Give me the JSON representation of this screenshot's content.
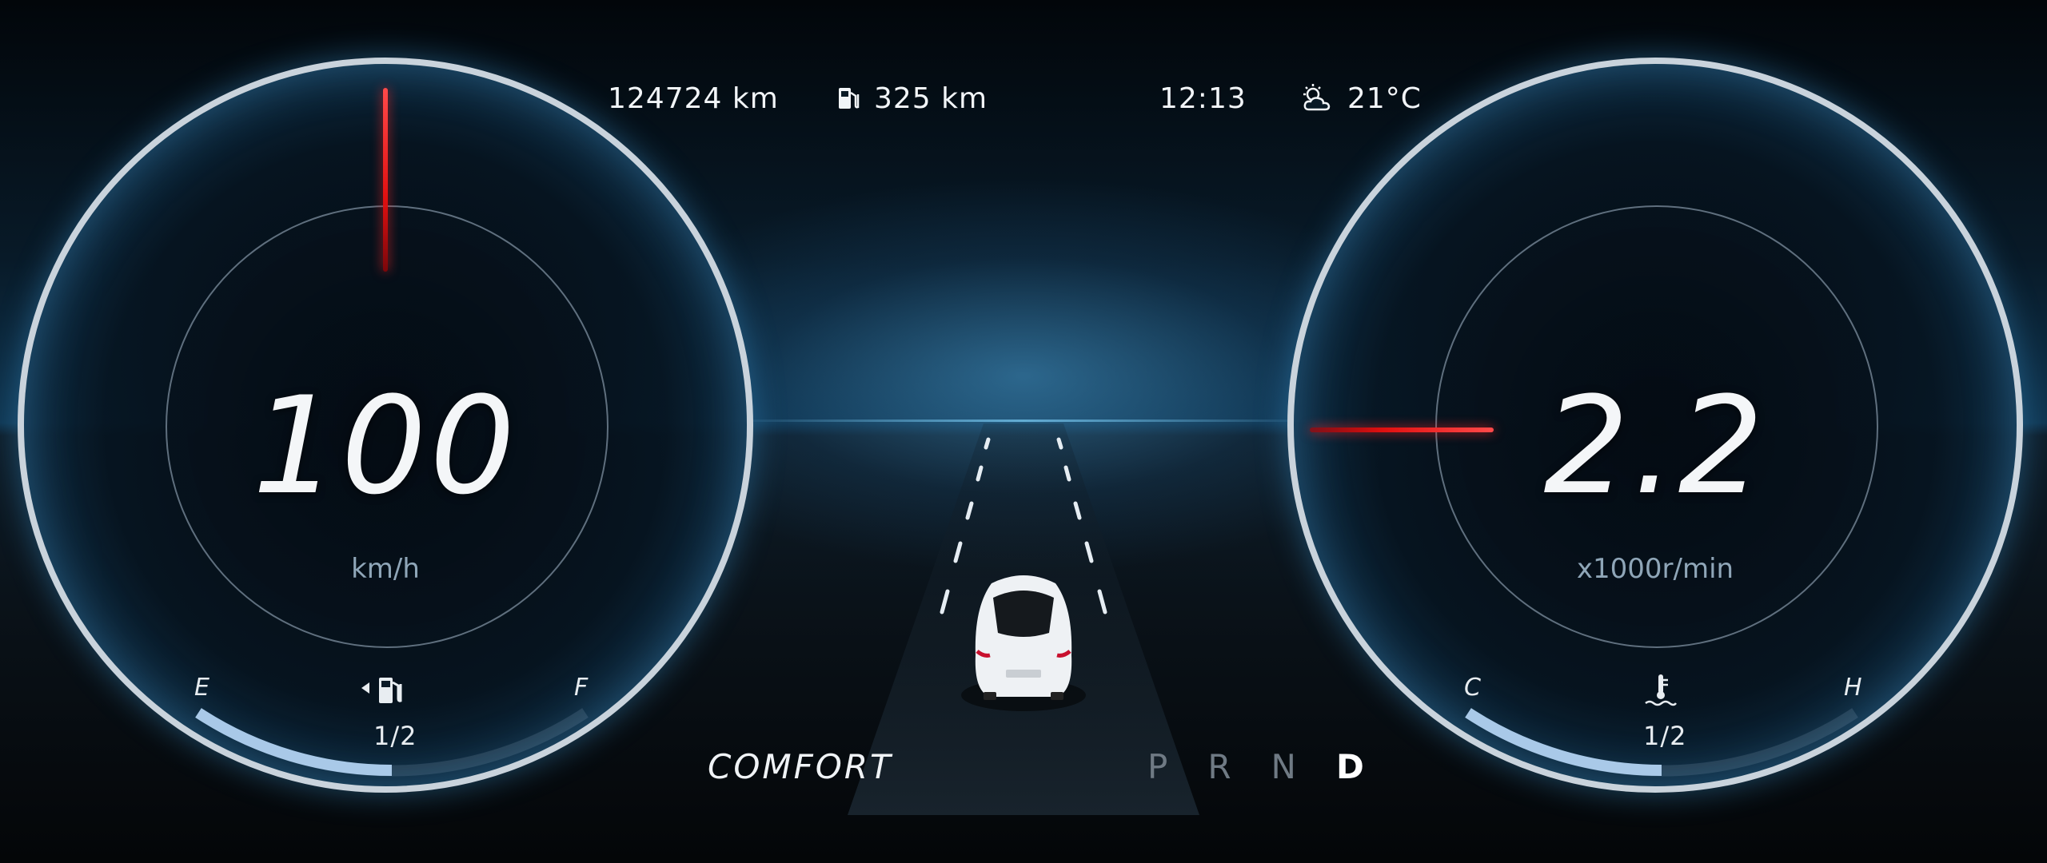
{
  "status_bar": {
    "odometer": "124724 km",
    "fuel_range": "325 km",
    "fuel_range_icon": "fuel-pump-icon",
    "clock": "12:13",
    "weather_icon": "partly-cloudy-icon",
    "temperature": "21°C"
  },
  "speedometer": {
    "value": "100",
    "unit": "km/h",
    "needle_color": "#e01010"
  },
  "fuel_gauge": {
    "empty_label": "E",
    "full_label": "F",
    "level_text": "1/2",
    "level_fraction": 0.5,
    "icon": "fuel-pump-icon",
    "side_indicator_icon": "left-triangle-icon"
  },
  "tachometer": {
    "value": "2.2",
    "unit": "x1000r/min",
    "needle_color": "#e01010"
  },
  "temp_gauge": {
    "cold_label": "C",
    "hot_label": "H",
    "level_text": "1/2",
    "level_fraction": 0.5,
    "icon": "coolant-temp-icon"
  },
  "drive_mode": "COMFORT",
  "gear_selector": {
    "gears": [
      "P",
      "R",
      "N",
      "D"
    ],
    "active": "D"
  },
  "colors": {
    "accent_blue": "#4a9ed6",
    "needle_red": "#e01010",
    "level_fill": "#a9c9e8"
  }
}
